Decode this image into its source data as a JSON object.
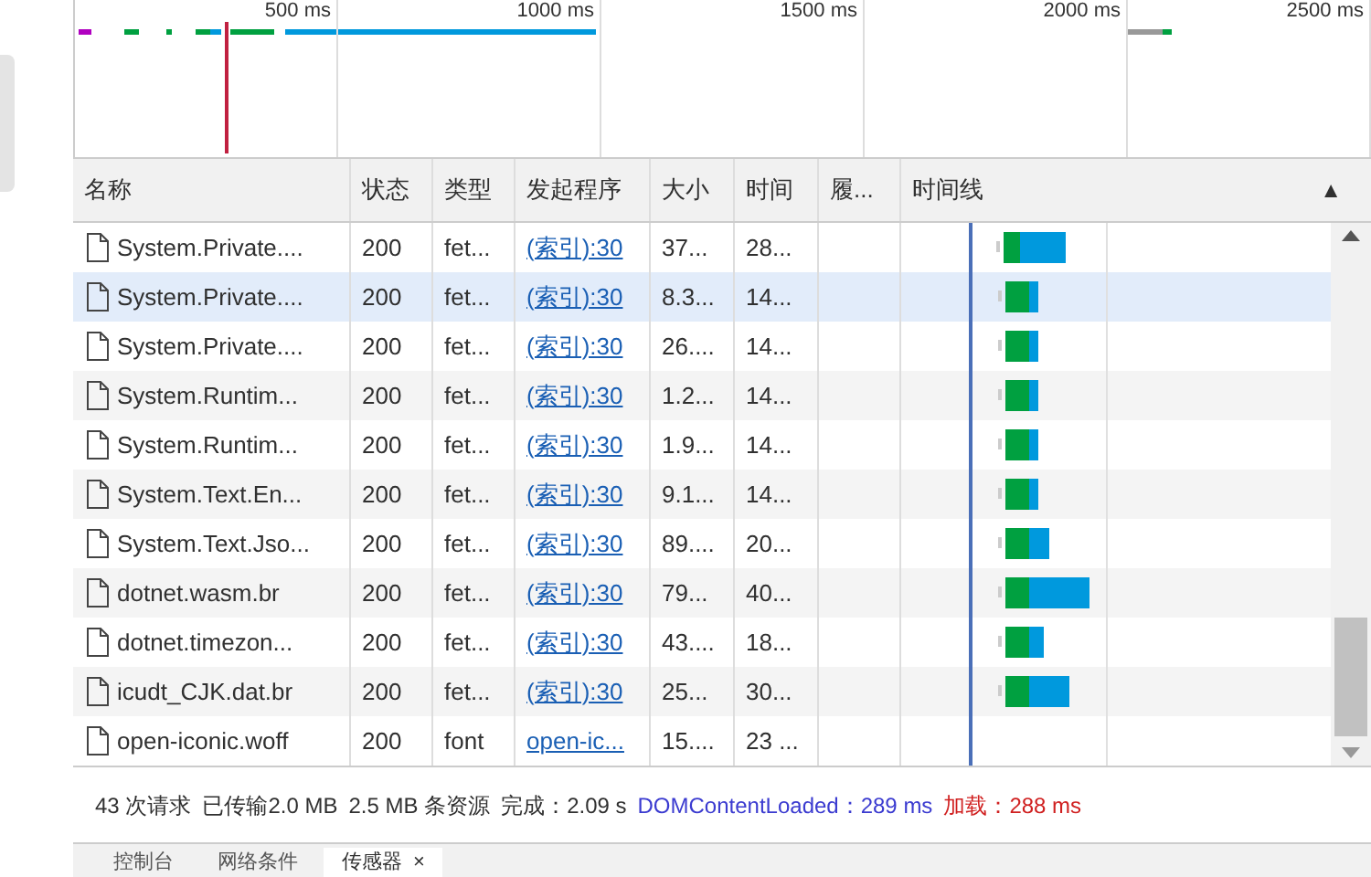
{
  "overview": {
    "ticks": [
      "500 ms",
      "1000 ms",
      "1500 ms",
      "2000 ms",
      "2500 ms"
    ]
  },
  "table": {
    "columns": [
      "名称",
      "状态",
      "类型",
      "发起程序",
      "大小",
      "时间",
      "履...",
      "时间线"
    ],
    "sort_icon": "▲",
    "rows": [
      {
        "name": "System.Private....",
        "status": "200",
        "type": "fet...",
        "initiator": "(索引):30",
        "size": "37...",
        "time": "28...",
        "selected": false
      },
      {
        "name": "System.Private....",
        "status": "200",
        "type": "fet...",
        "initiator": "(索引):30",
        "size": "8.3...",
        "time": "14...",
        "selected": true
      },
      {
        "name": "System.Private....",
        "status": "200",
        "type": "fet...",
        "initiator": "(索引):30",
        "size": "26....",
        "time": "14...",
        "selected": false
      },
      {
        "name": "System.Runtim...",
        "status": "200",
        "type": "fet...",
        "initiator": "(索引):30",
        "size": "1.2...",
        "time": "14...",
        "selected": false
      },
      {
        "name": "System.Runtim...",
        "status": "200",
        "type": "fet...",
        "initiator": "(索引):30",
        "size": "1.9...",
        "time": "14...",
        "selected": false
      },
      {
        "name": "System.Text.En...",
        "status": "200",
        "type": "fet...",
        "initiator": "(索引):30",
        "size": "9.1...",
        "time": "14...",
        "selected": false
      },
      {
        "name": "System.Text.Jso...",
        "status": "200",
        "type": "fet...",
        "initiator": "(索引):30",
        "size": "89....",
        "time": "20...",
        "selected": false
      },
      {
        "name": "dotnet.wasm.br",
        "status": "200",
        "type": "fet...",
        "initiator": "(索引):30",
        "size": "79...",
        "time": "40...",
        "selected": false
      },
      {
        "name": "dotnet.timezon...",
        "status": "200",
        "type": "fet...",
        "initiator": "(索引):30",
        "size": "43....",
        "time": "18...",
        "selected": false
      },
      {
        "name": "icudt_CJK.dat.br",
        "status": "200",
        "type": "fet...",
        "initiator": "(索引):30",
        "size": "25...",
        "time": "30...",
        "selected": false
      },
      {
        "name": "open-iconic.woff",
        "status": "200",
        "type": "font",
        "initiator": "open-ic...",
        "size": "15....",
        "time": "23 ...",
        "selected": false
      }
    ]
  },
  "status_bar": [
    {
      "text": "43 次请求",
      "kind": "plain"
    },
    {
      "text": "已传输2.0 MB",
      "kind": "plain"
    },
    {
      "text": "2.5 MB 条资源",
      "kind": "plain"
    },
    {
      "text": "完成：2.09 s",
      "kind": "plain"
    },
    {
      "text": "DOMContentLoaded：289 ms",
      "kind": "dom"
    },
    {
      "text": "加载：288 ms",
      "kind": "load"
    }
  ],
  "drawer_tabs": [
    {
      "label": "控制台",
      "selected": false
    },
    {
      "label": "网络条件",
      "selected": false
    },
    {
      "label": "传感器",
      "selected": true,
      "close": "×"
    }
  ]
}
